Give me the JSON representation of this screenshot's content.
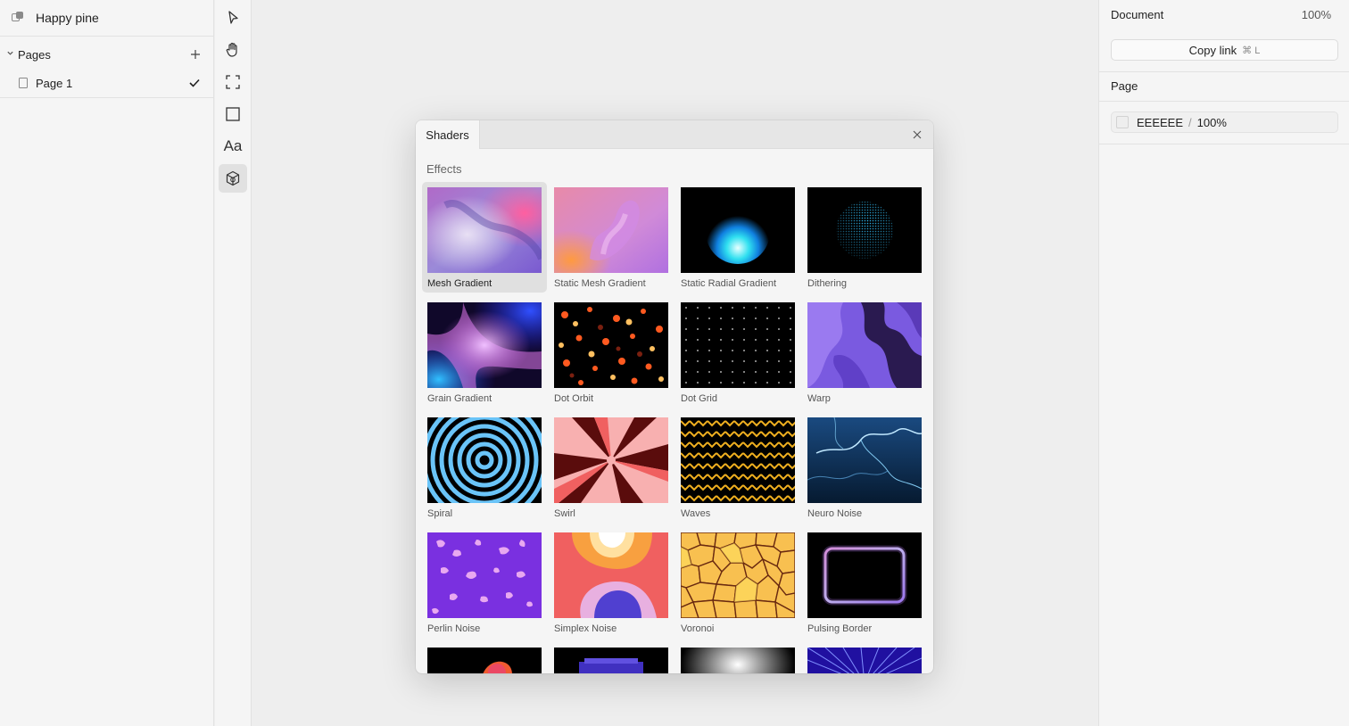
{
  "document": {
    "title": "Happy pine"
  },
  "pages": {
    "header": "Pages",
    "items": [
      {
        "label": "Page 1",
        "selected": true
      }
    ]
  },
  "tools": [
    "pointer-icon",
    "hand-icon",
    "frame-icon",
    "rectangle-icon",
    "text-icon",
    "shader-icon"
  ],
  "tools_text": {
    "text_tool": "Aa"
  },
  "right_panel": {
    "document_label": "Document",
    "zoom": "100%",
    "copy_link": "Copy link",
    "copy_shortcut": "⌘ L",
    "page_label": "Page",
    "background_hex": "EEEEEE",
    "background_opacity": "100%"
  },
  "modal": {
    "tab": "Shaders",
    "section": "Effects",
    "items": [
      {
        "label": "Mesh Gradient",
        "selected": true
      },
      {
        "label": "Static Mesh Gradient"
      },
      {
        "label": "Static Radial Gradient"
      },
      {
        "label": "Dithering"
      },
      {
        "label": "Grain Gradient"
      },
      {
        "label": "Dot Orbit"
      },
      {
        "label": "Dot Grid"
      },
      {
        "label": "Warp"
      },
      {
        "label": "Spiral"
      },
      {
        "label": "Swirl"
      },
      {
        "label": "Waves"
      },
      {
        "label": "Neuro Noise"
      },
      {
        "label": "Perlin Noise"
      },
      {
        "label": "Simplex Noise"
      },
      {
        "label": "Voronoi"
      },
      {
        "label": "Pulsing Border"
      }
    ]
  }
}
